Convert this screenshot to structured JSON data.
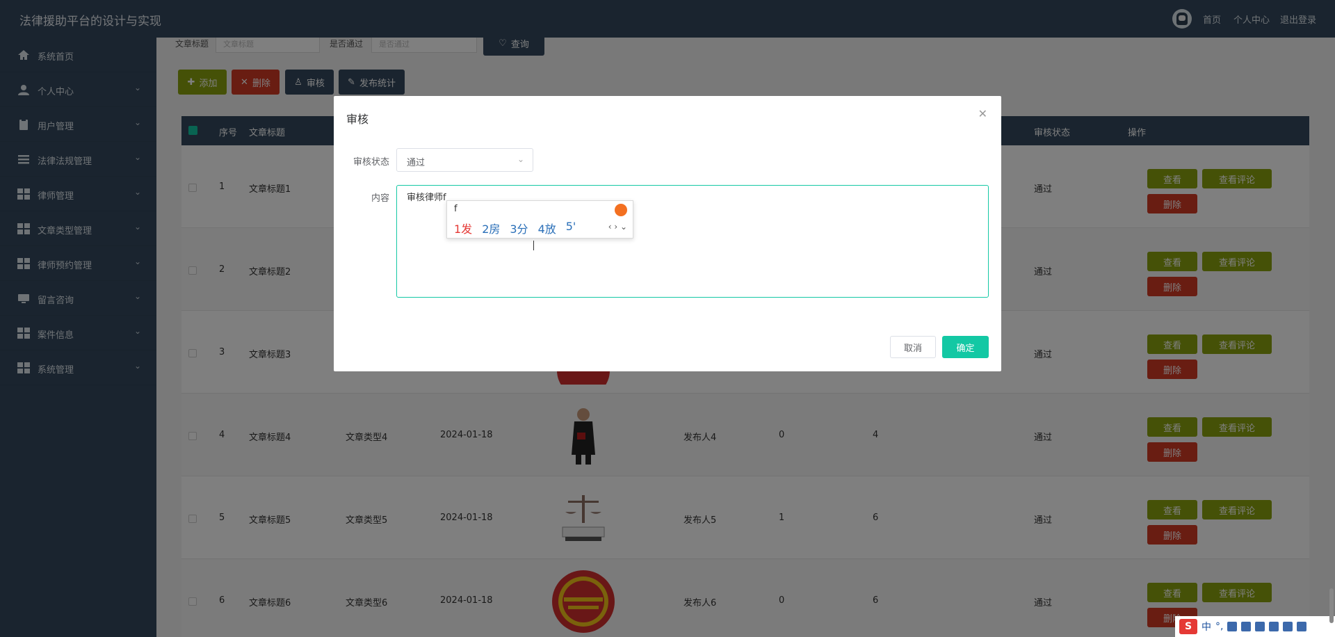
{
  "app": {
    "title": "法律援助平台的设计与实现"
  },
  "topnav": {
    "home": "首页",
    "profile": "个人中心",
    "logout": "退出登录"
  },
  "sidebar": {
    "items": [
      {
        "label": "系统首页",
        "icon": "home-icon"
      },
      {
        "label": "个人中心",
        "icon": "user-icon"
      },
      {
        "label": "用户管理",
        "icon": "clipboard-icon"
      },
      {
        "label": "法律法规管理",
        "icon": "list-icon"
      },
      {
        "label": "律师管理",
        "icon": "grid-icon"
      },
      {
        "label": "文章类型管理",
        "icon": "grid-icon"
      },
      {
        "label": "律师预约管理",
        "icon": "grid-icon"
      },
      {
        "label": "留言咨询",
        "icon": "monitor-icon"
      },
      {
        "label": "案件信息",
        "icon": "grid-icon"
      },
      {
        "label": "系统管理",
        "icon": "grid-icon"
      }
    ]
  },
  "search": {
    "title_label": "文章标题",
    "title_placeholder": "文章标题",
    "pass_label": "是否通过",
    "pass_placeholder": "是否通过",
    "query": "查询"
  },
  "toolbar": {
    "add": "添加",
    "delete": "删除",
    "audit": "审核",
    "stats": "发布统计"
  },
  "table": {
    "headers": {
      "index": "序号",
      "title": "文章标题",
      "status": "审核状态",
      "ops": "操作"
    },
    "rows": [
      {
        "index": "1",
        "title": "文章标题1",
        "status": "通过"
      },
      {
        "index": "2",
        "title": "文章标题2",
        "status": "通过"
      },
      {
        "index": "3",
        "title": "文章标题3",
        "status": "通过"
      },
      {
        "index": "4",
        "title": "文章标题4",
        "type": "文章类型4",
        "date": "2024-01-18",
        "publisher": "发布人4",
        "num1": "0",
        "num2": "4",
        "status": "通过"
      },
      {
        "index": "5",
        "title": "文章标题5",
        "type": "文章类型5",
        "date": "2024-01-18",
        "publisher": "发布人5",
        "num1": "1",
        "num2": "6",
        "status": "通过"
      },
      {
        "index": "6",
        "title": "文章标题6",
        "type": "文章类型6",
        "date": "2024-01-18",
        "publisher": "发布人6",
        "num1": "0",
        "num2": "6",
        "status": "通过"
      }
    ],
    "row_buttons": {
      "view": "查看",
      "comments": "查看评论",
      "delete": "删除"
    }
  },
  "dialog": {
    "title": "审核",
    "status_label": "审核状态",
    "status_value": "通过",
    "content_label": "内容",
    "content_value": "审核律师f",
    "cancel": "取消",
    "confirm": "确定"
  },
  "ime": {
    "pinyin": "f",
    "candidates": [
      "1发",
      "2房",
      "3分",
      "4放",
      "5'"
    ]
  },
  "tray": {
    "lang": "中"
  },
  "colors": {
    "primary": "#34495e",
    "accent": "#13c8a4",
    "green": "#8ba30f",
    "red": "#d33a25"
  }
}
